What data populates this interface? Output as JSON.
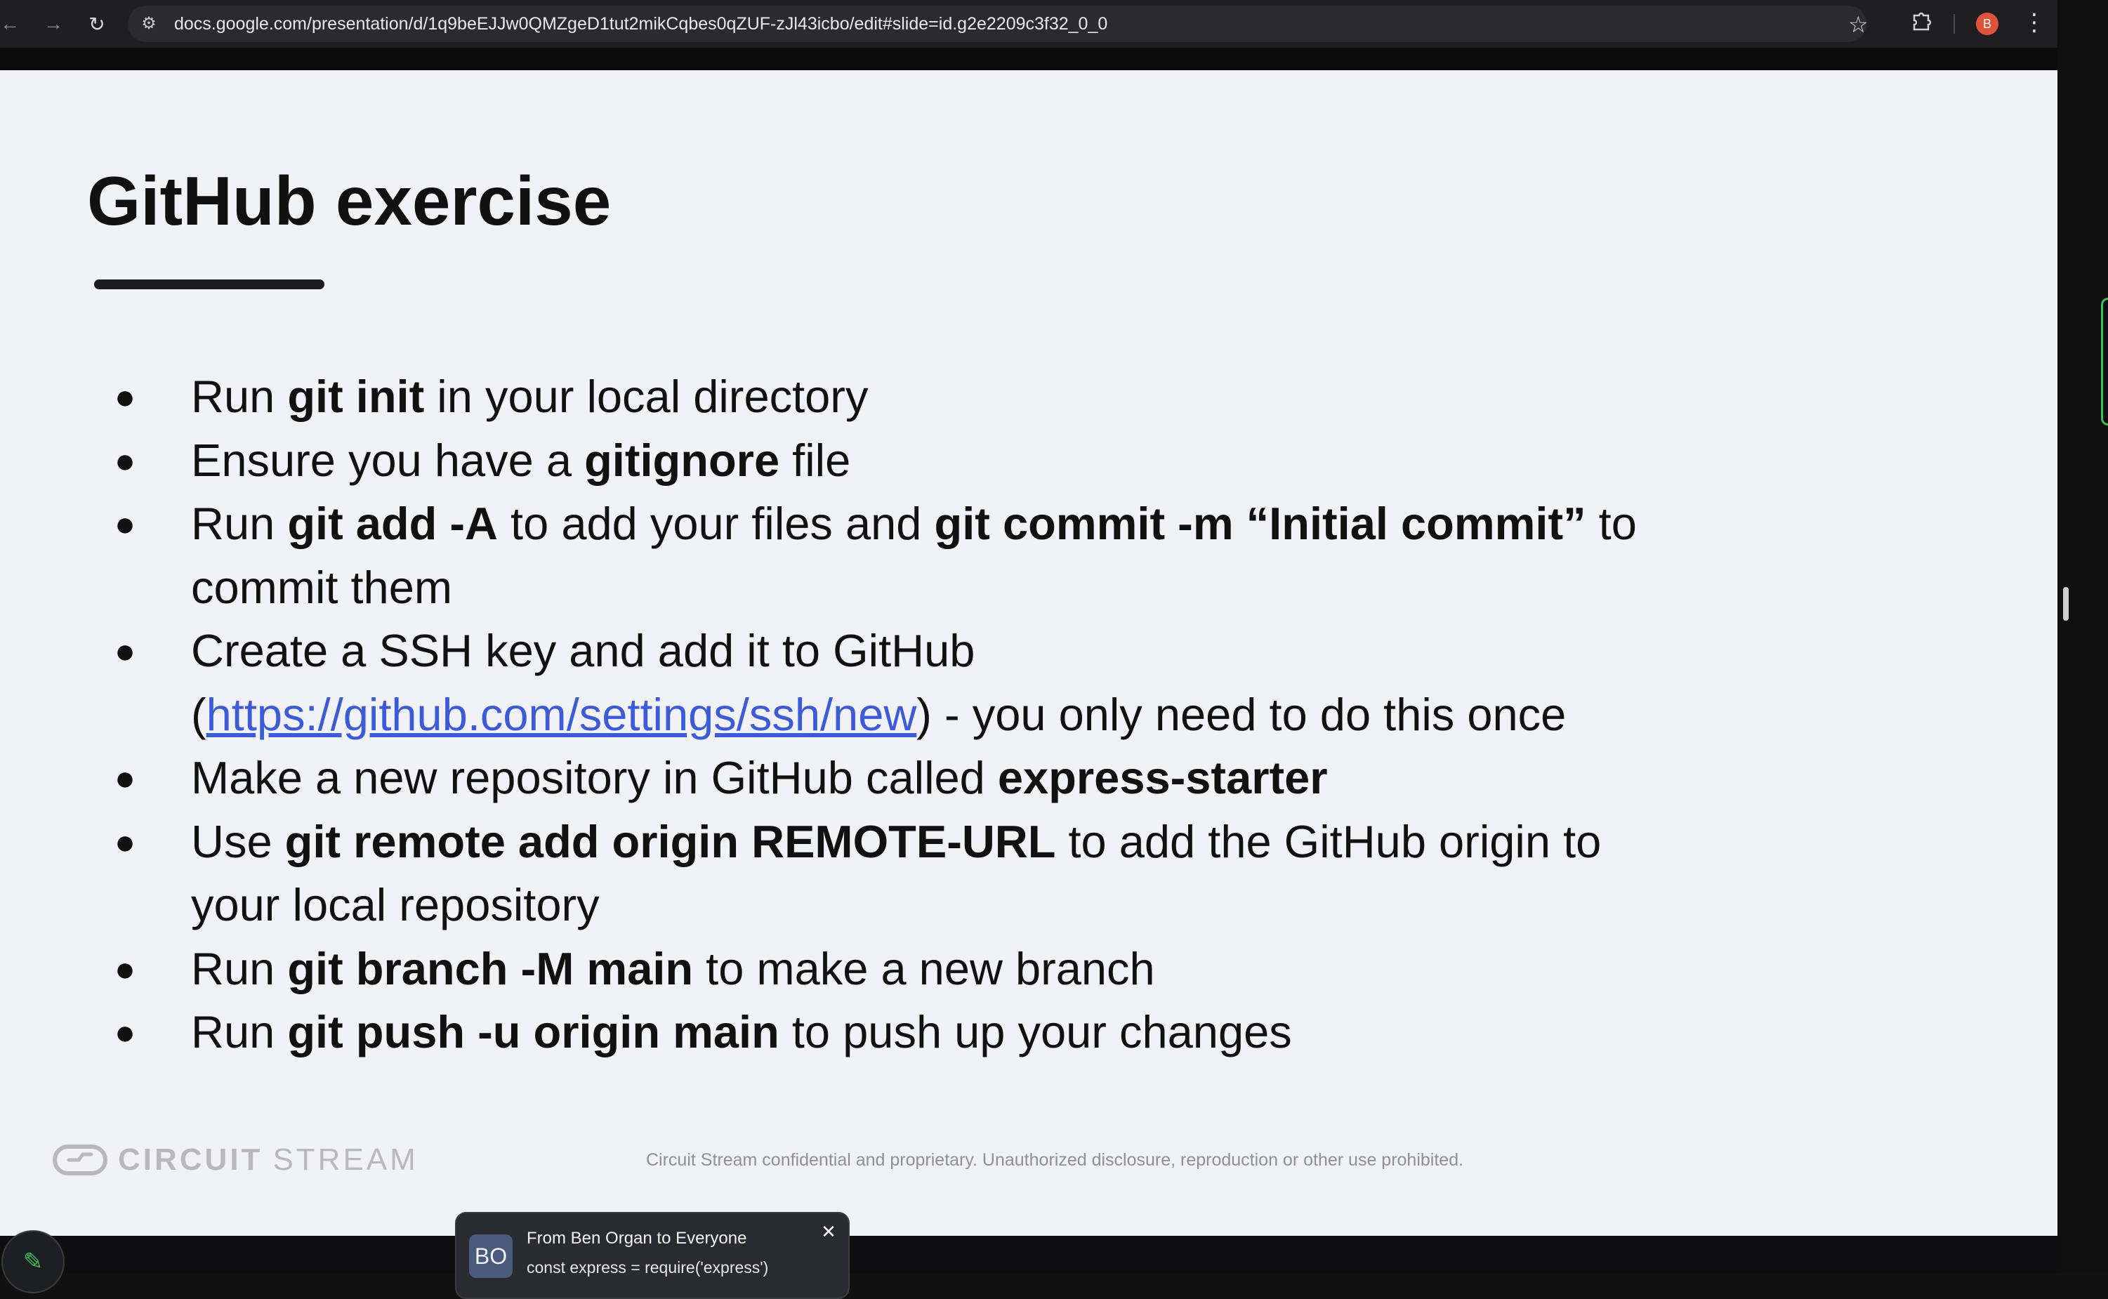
{
  "browser": {
    "url": "docs.google.com/presentation/d/1q9beEJJw0QMZgeD1tut2mikCqbes0qZUF-zJl43icbo/edit#slide=id.g2e2209c3f32_0_0",
    "profile_initial": "B",
    "icons": {
      "back": "back-arrow-icon",
      "forward": "forward-arrow-icon",
      "reload": "reload-icon",
      "site_settings": "tune-icon",
      "bookmark": "star-icon",
      "extensions": "puzzle-icon",
      "menu": "kebab-menu-icon"
    }
  },
  "slide": {
    "title": "GitHub exercise",
    "bullets": [
      {
        "p1": "Run ",
        "b1": "git init",
        "p2": " in your local directory"
      },
      {
        "p1": "Ensure you have a ",
        "b1": "gitignore",
        "p2": " file"
      },
      {
        "p1": "Run ",
        "b1": "git add -A",
        "p2": " to add your files and ",
        "b2": "git commit -m “Initial commit”",
        "p3": " to",
        "line2": "commit them"
      },
      {
        "line1": "Create a SSH key and add it to GitHub",
        "open": "(",
        "link": "https://github.com/settings/ssh/new",
        "close": ") - you only need to do this once"
      },
      {
        "p1": "Make a new repository in GitHub called ",
        "b1": "express-starter"
      },
      {
        "p1": "Use ",
        "b1": "git remote add origin REMOTE-URL",
        "p2": " to add the GitHub origin to",
        "line2": "your local repository"
      },
      {
        "p1": "Run ",
        "b1": "git branch -M main",
        "p2": " to make a new branch"
      },
      {
        "p1": "Run ",
        "b1": "git push -u origin main",
        "p2": " to push up your changes"
      }
    ],
    "footer": {
      "logo_part1": "CIRCUIT",
      "logo_part2": "STREAM",
      "note": "Circuit Stream confidential and proprietary. Unauthorized disclosure, reproduction or other use prohibited."
    }
  },
  "chat": {
    "avatar_initials": "BO",
    "from": "From Ben Organ to Everyone",
    "message": "const express = require('express')"
  },
  "colors": {
    "link": "#3d5bd6",
    "accent_green": "#3fbf5a",
    "slide_bg": "#f1f2f6"
  }
}
